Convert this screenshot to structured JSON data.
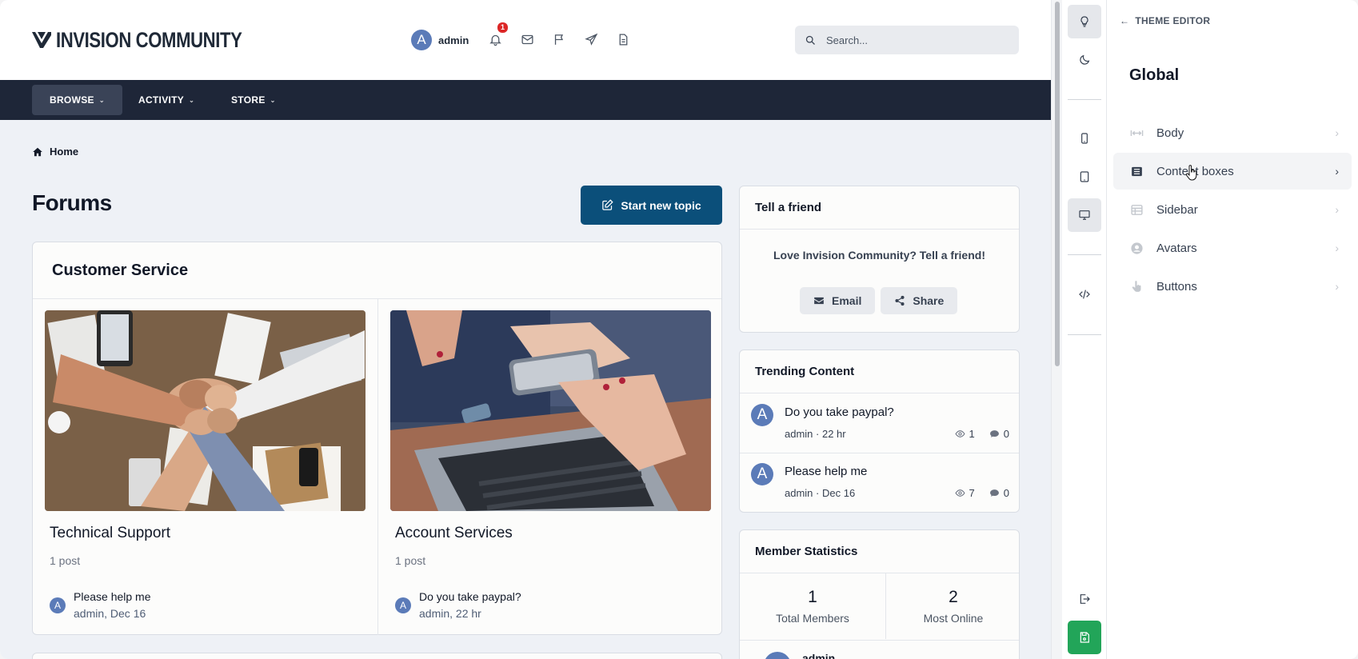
{
  "site": {
    "logo_text": "INVISION COMMUNITY",
    "user": {
      "initial": "A",
      "name": "admin"
    },
    "notification_count": "1",
    "search_placeholder": "Search...",
    "nav": [
      {
        "label": "BROWSE"
      },
      {
        "label": "ACTIVITY"
      },
      {
        "label": "STORE"
      }
    ],
    "breadcrumb_home": "Home",
    "page_title": "Forums",
    "start_topic_label": "Start new topic"
  },
  "category": {
    "title": "Customer Service",
    "forums": [
      {
        "name": "Technical Support",
        "count": "1 post",
        "last_title": "Please help me",
        "last_meta": "admin, Dec 16",
        "avatar": "A"
      },
      {
        "name": "Account Services",
        "count": "1 post",
        "last_title": "Do you take paypal?",
        "last_meta": "admin, 22 hr",
        "avatar": "A"
      }
    ]
  },
  "widgets": {
    "tell": {
      "title": "Tell a friend",
      "text": "Love Invision Community? Tell a friend!",
      "email_label": "Email",
      "share_label": "Share"
    },
    "trending": {
      "title": "Trending Content",
      "items": [
        {
          "title": "Do you take paypal?",
          "author": "admin",
          "time": "22 hr",
          "views": "1",
          "comments": "0",
          "avatar": "A"
        },
        {
          "title": "Please help me",
          "author": "admin",
          "time": "Dec 16",
          "views": "7",
          "comments": "0",
          "avatar": "A"
        }
      ]
    },
    "members": {
      "title": "Member Statistics",
      "total_members": "1",
      "total_members_label": "Total Members",
      "most_online": "2",
      "most_online_label": "Most Online",
      "partial_name": "admin"
    }
  },
  "editor": {
    "back_label": "THEME EDITOR",
    "section_title": "Global",
    "items": [
      {
        "label": "Body",
        "icon": "arrows-h-icon"
      },
      {
        "label": "Content boxes",
        "icon": "list-icon"
      },
      {
        "label": "Sidebar",
        "icon": "table-icon"
      },
      {
        "label": "Avatars",
        "icon": "user-circle-icon"
      },
      {
        "label": "Buttons",
        "icon": "hand-pointer-icon"
      }
    ]
  },
  "colors": {
    "nav_bg": "#1e2638",
    "primary_button": "#0b4f7a",
    "save_button": "#22a559",
    "badge": "#dc2626",
    "avatar": "#5b7bb8"
  }
}
